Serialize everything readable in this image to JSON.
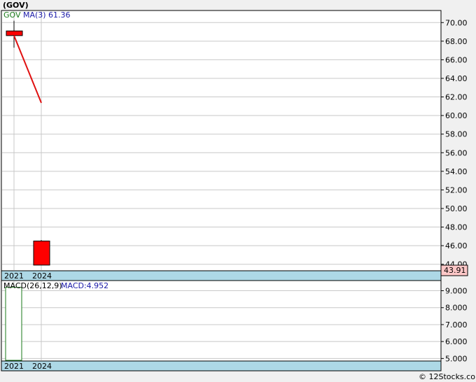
{
  "title": "(GOV)",
  "legend": {
    "ticker": "GOV",
    "ma_label": "MA(3)",
    "ma_value": "61.36",
    "macd_label": "MACD(26,12,9)",
    "macd_value_label": "MACD:4.952"
  },
  "last_price": "43.91",
  "watermark": "© 12Stocks.com",
  "colors": {
    "ticker": "#1a7a1a",
    "ma_line": "#e01010",
    "candle_fill": "#ff0000",
    "macd_text": "#1a1aa8",
    "date_band": "#add8e6",
    "price_tag_bg": "#ffc8c8",
    "grid": "#c8c8c8"
  },
  "chart_data": [
    {
      "type": "candlestick",
      "name": "price",
      "x": [
        "2021",
        "2024"
      ],
      "ylim": [
        43.3,
        71.3
      ],
      "y_ticks": [
        44,
        46,
        48,
        50,
        52,
        54,
        56,
        58,
        60,
        62,
        64,
        66,
        68,
        70
      ],
      "y_tick_labels": [
        "44.00",
        "46.00",
        "48.00",
        "50.00",
        "52.00",
        "54.00",
        "56.00",
        "58.00",
        "60.00",
        "62.00",
        "64.00",
        "66.00",
        "68.00",
        "70.00"
      ],
      "candles": [
        {
          "x": "2021",
          "open": 69.1,
          "high": 70.2,
          "low": 67.3,
          "close": 68.6
        },
        {
          "x": "2024",
          "open": 46.5,
          "high": 46.6,
          "low": 43.91,
          "close": 43.91
        }
      ],
      "ma_line": {
        "name": "MA(3)",
        "x": [
          "2021",
          "2024"
        ],
        "values": [
          68.6,
          61.36
        ]
      },
      "grid": true
    },
    {
      "type": "bar",
      "name": "MACD(26,12,9)",
      "x": [
        "2021",
        "2024"
      ],
      "values": [
        9.2,
        4.952
      ],
      "ylim": [
        4.85,
        9.6
      ],
      "y_ticks": [
        5,
        6,
        7,
        8,
        9
      ],
      "y_tick_labels": [
        "5.000",
        "6.000",
        "7.000",
        "8.000",
        "9.000"
      ],
      "grid": true
    }
  ]
}
